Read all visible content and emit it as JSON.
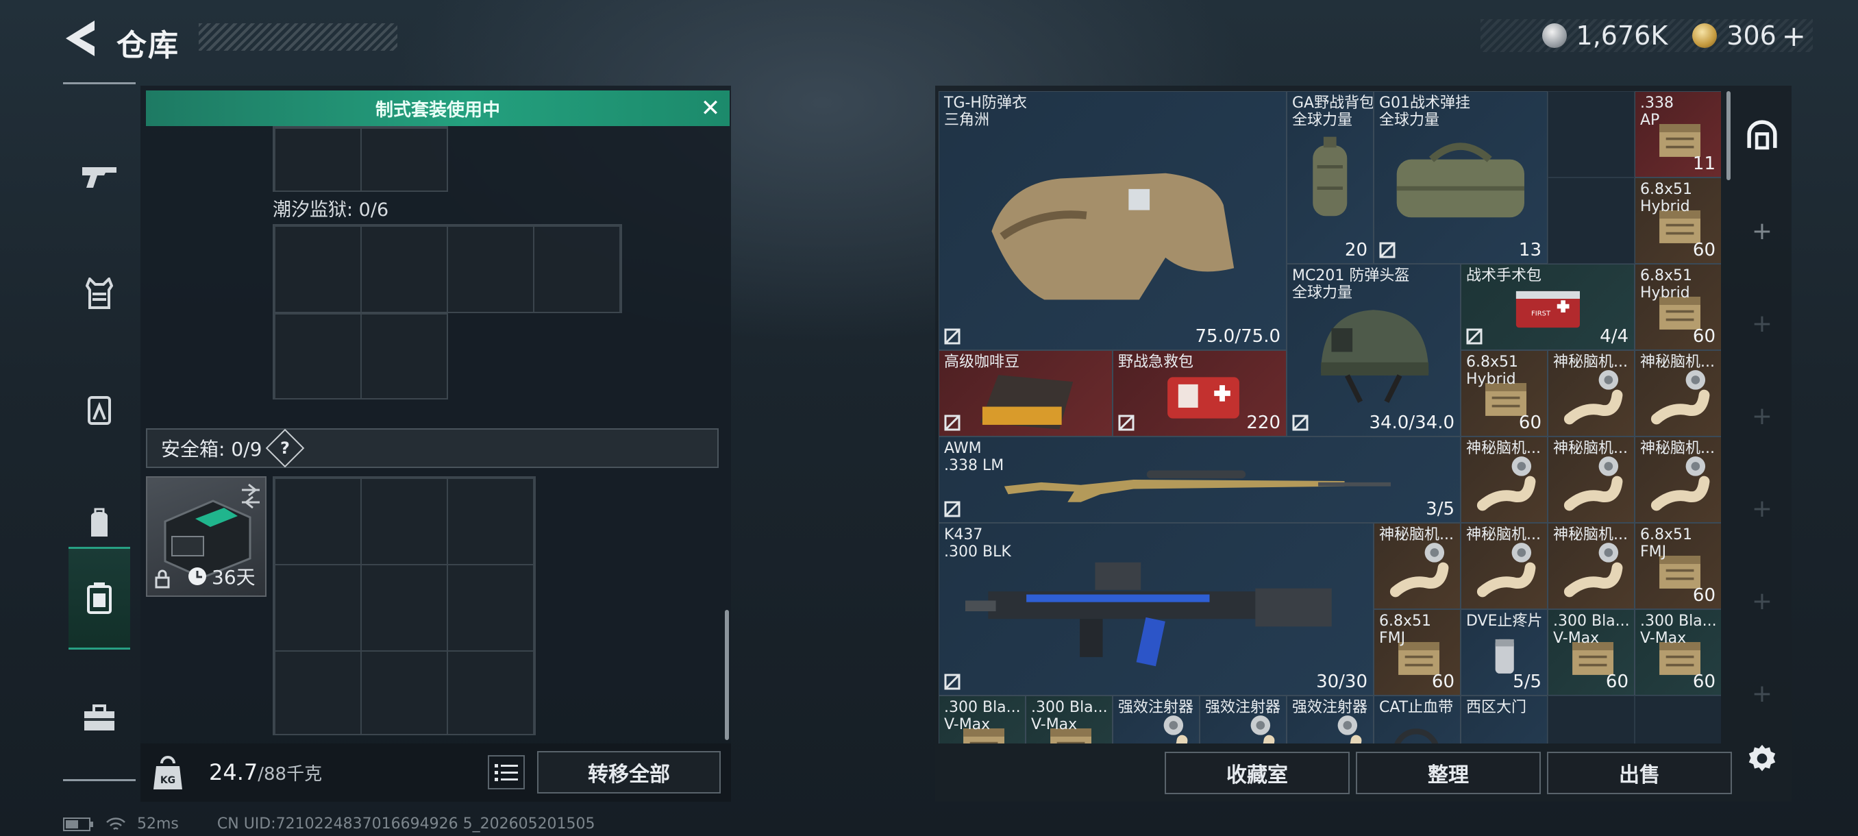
{
  "header": {
    "title": "仓库",
    "back_icon": "back-arrow-icon",
    "currency": [
      {
        "icon": "silver-coin-icon",
        "value": "1,676K"
      },
      {
        "icon": "gold-coin-icon",
        "value": "306"
      },
      {
        "plus": "+"
      }
    ]
  },
  "left_nav": [
    {
      "icon": "gun-icon",
      "active": false
    },
    {
      "icon": "vest-icon",
      "active": false
    },
    {
      "icon": "chest-rig-icon",
      "active": false
    },
    {
      "icon": "backpack-icon",
      "active": false
    },
    {
      "icon": "safe-box-icon",
      "active": true
    },
    {
      "icon": "toolbox-icon",
      "active": false
    }
  ],
  "loadout": {
    "kit_banner": "制式套装使用中",
    "prison_label": "潮汐监狱: 0/6",
    "safe_label": "安全箱: 0/9",
    "help_icon": "?",
    "safe_timer": "36天",
    "weight_value": "24.7",
    "weight_unit": "/88千克",
    "transfer_all": "转移全部"
  },
  "status_bar": {
    "ping": "52ms",
    "uid": "CN UID:7210224837016694926 5_202605201505"
  },
  "stash_items": [
    {
      "name": "TG-H防弹衣\n三角洲",
      "value": "75.0/75.0",
      "color": "blue"
    },
    {
      "name": "GA野战背包\n全球力量",
      "value": "20",
      "color": "blue"
    },
    {
      "name": "G01战术弹挂\n全球力量",
      "value": "13",
      "color": "blue"
    },
    {
      "name": ".338\nAP",
      "value": "11",
      "color": "red"
    },
    {
      "name": "6.8x51\nHybrid",
      "value": "60",
      "color": "brown"
    },
    {
      "name": "MC201 防弹头盔\n全球力量",
      "value": "34.0/34.0",
      "color": "blue"
    },
    {
      "name": "战术手术包",
      "value": "4/4",
      "color": "teal"
    },
    {
      "name": "6.8x51\nHybrid",
      "value": "60",
      "color": "brown"
    },
    {
      "name": "高级咖啡豆",
      "value": "",
      "color": "red"
    },
    {
      "name": "野战急救包",
      "value": "220",
      "color": "red"
    },
    {
      "name": "6.8x51\nHybrid",
      "value": "60",
      "color": "brown"
    },
    {
      "name": "神秘脑机...",
      "value": "",
      "color": "brown"
    },
    {
      "name": "神秘脑机...",
      "value": "",
      "color": "brown"
    },
    {
      "name": "AWM\n.338 LM",
      "value": "3/5",
      "color": "blue"
    },
    {
      "name": "神秘脑机...",
      "value": "",
      "color": "brown"
    },
    {
      "name": "神秘脑机...",
      "value": "",
      "color": "brown"
    },
    {
      "name": "神秘脑机...",
      "value": "",
      "color": "brown"
    },
    {
      "name": "K437\n.300 BLK",
      "value": "30/30",
      "color": "blue"
    },
    {
      "name": "神秘脑机...",
      "value": "",
      "color": "brown"
    },
    {
      "name": "神秘脑机...",
      "value": "",
      "color": "brown"
    },
    {
      "name": "神秘脑机...",
      "value": "",
      "color": "brown"
    },
    {
      "name": "6.8x51\nFMJ",
      "value": "60",
      "color": "brown"
    },
    {
      "name": "6.8x51\nFMJ",
      "value": "60",
      "color": "brown"
    },
    {
      "name": "DVE止疼片",
      "value": "5/5",
      "color": "blue"
    },
    {
      "name": ".300 Bla...\nV-Max",
      "value": "60",
      "color": "teal"
    },
    {
      "name": ".300 Bla...\nV-Max",
      "value": "60",
      "color": "teal"
    },
    {
      "name": ".300 Bla...\nV-Max",
      "value": "",
      "color": "teal"
    },
    {
      "name": ".300 Bla...\nV-Max",
      "value": "",
      "color": "teal"
    },
    {
      "name": "强效注射器",
      "value": "",
      "color": "blue"
    },
    {
      "name": "强效注射器",
      "value": "",
      "color": "blue"
    },
    {
      "name": "强效注射器",
      "value": "",
      "color": "blue"
    },
    {
      "name": "CAT止血带",
      "value": "",
      "color": "blue"
    },
    {
      "name": "西区大门",
      "value": "",
      "color": "blue"
    }
  ],
  "bottom_buttons": [
    "收藏室",
    "整理",
    "出售"
  ],
  "right_nav": {
    "plus": "+"
  }
}
